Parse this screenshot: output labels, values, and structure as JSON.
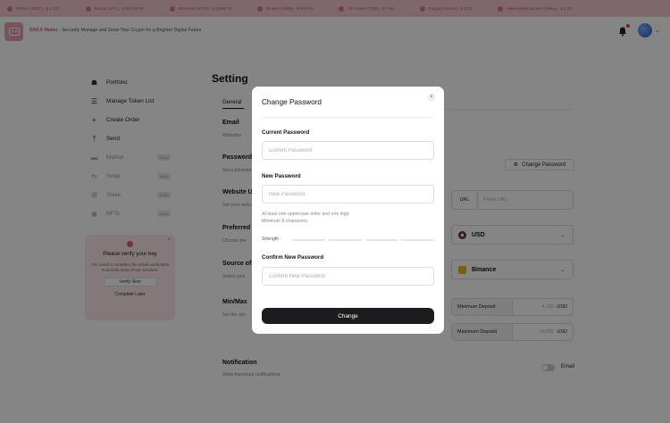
{
  "ticker": [
    {
      "name": "Tether (USDT) : $ 1.001",
      "icon": "tether-icon"
    },
    {
      "name": "Bitcoin (BTC) : $ 62,048.97",
      "icon": "bitcoin-icon"
    },
    {
      "name": "Ethereum (ETH) : $ 3,658.74",
      "icon": "ethereum-icon"
    },
    {
      "name": "Binance (BNB) : $ 605.24",
      "icon": "binance-icon"
    },
    {
      "name": "Ton Token (TON) : $ 7.06",
      "icon": "ton-icon"
    },
    {
      "name": "Polygon (Matic) : $ 0.53",
      "icon": "polygon-icon"
    },
    {
      "name": "Naka-wallet-Summit (Naka) : $ 1.23",
      "icon": "naka-icon"
    }
  ],
  "header": {
    "brand_name": "NAKA Wallet",
    "tagline": " - Securely Manage and Grow Your Crypto for a Brighter Digital Future"
  },
  "sidebar": {
    "items": [
      {
        "label": "Portfolio",
        "icon": "home-icon",
        "soon": ""
      },
      {
        "label": "Manage Token List",
        "icon": "list-icon",
        "soon": ""
      },
      {
        "label": "Create Order",
        "icon": "plus-icon",
        "soon": ""
      },
      {
        "label": "Send",
        "icon": "upload-icon",
        "soon": ""
      },
      {
        "label": "Market",
        "icon": "folder-icon",
        "soon": "Soon"
      },
      {
        "label": "Swap",
        "icon": "swap-icon",
        "soon": "Soon"
      },
      {
        "label": "Stake",
        "icon": "stake-icon",
        "soon": "Soon"
      },
      {
        "label": "NFTs",
        "icon": "nft-icon",
        "soon": "Soon"
      }
    ]
  },
  "verify_card": {
    "title": "Please verify your key",
    "description": "You need to complete the email verification to access more of our services.",
    "verify_button": "Verify Now",
    "later_button": "Complete Later",
    "close": "×"
  },
  "settings": {
    "title": "Setting",
    "tab_general": "General",
    "email_title": "Email",
    "email_sub": "Websites",
    "password_title": "Password",
    "password_sub": "Set a password",
    "change_password_button": "Change Password",
    "website_title": "Website URL",
    "website_sub": "Set your website",
    "url_label": "URL",
    "url_placeholder": "Press URL",
    "currency_title": "Preferred",
    "currency_sub": "Choose the",
    "currency_value": "USD",
    "source_title": "Source of",
    "source_sub": "Select your",
    "source_value": "Binance",
    "minmax_title": "Min/Max",
    "minmax_sub": "Set the min",
    "min_label": "Minimum Deposit",
    "min_value": "4,335",
    "min_unit": "USD",
    "max_label": "Maximum Deposit",
    "max_value": "10,000",
    "max_unit": "USD",
    "notification_title": "Notification",
    "notification_sub": "Allow important notifications.",
    "email_toggle_label": "Email"
  },
  "modal": {
    "title": "Change Password",
    "close": "×",
    "current_label": "Current Password",
    "current_placeholder": "Current Password",
    "new_label": "New Password",
    "new_placeholder": "New Password",
    "hint_line1": "At least one uppercase letter and one digit.",
    "hint_line2": "Minimum 8 characters.",
    "strength_label": "Strength :",
    "confirm_label": "Confirm New Password",
    "confirm_placeholder": "Confirm New Password",
    "submit": "Change"
  },
  "colors": {
    "accent": "#e35a7a",
    "ticker_bg": "#f3c7cf",
    "button_dark": "#1c1c1e"
  }
}
